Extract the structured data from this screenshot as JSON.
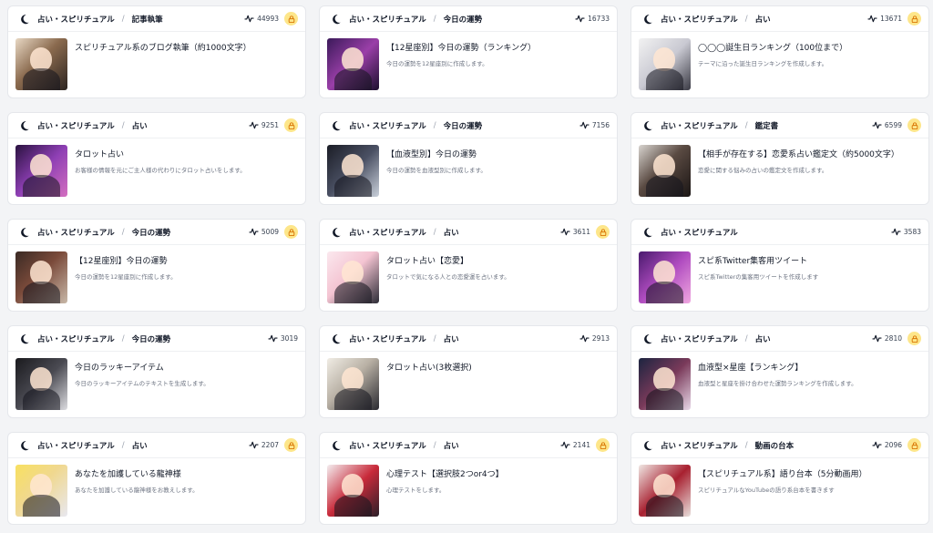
{
  "cards": [
    {
      "category": "占い・スピリチュアル",
      "sub": "記事執筆",
      "count": "44993",
      "locked": true,
      "title": "スピリチュアル系のブログ執筆（約1000文字）",
      "desc": "",
      "thumb_bg": "linear-gradient(135deg,#e8d8c4 0%,#8a6a4e 45%,#2c2420 100%)"
    },
    {
      "category": "占い・スピリチュアル",
      "sub": "今日の運勢",
      "count": "16733",
      "locked": false,
      "title": "【12星座別】今日の運勢（ランキング）",
      "desc": "今日の運勢を12星座別に作成します。",
      "thumb_bg": "linear-gradient(135deg,#3b1a5a 0%,#9a3fa8 50%,#1c0f2e 100%)"
    },
    {
      "category": "占い・スピリチュアル",
      "sub": "占い",
      "count": "13671",
      "locked": true,
      "title": "◯◯◯誕生日ランキング（100位まで）",
      "desc": "テーマに沿った誕生日ランキングを作成します。",
      "thumb_bg": "linear-gradient(135deg,#f2f2f2 0%,#c9c9d2 50%,#3a3a44 100%)"
    },
    {
      "category": "占い・スピリチュアル",
      "sub": "占い",
      "count": "9251",
      "locked": true,
      "title": "タロット占い",
      "desc": "お客様の情報を元にご主人様の代わりにタロット占いをします。",
      "thumb_bg": "linear-gradient(135deg,#2a1240 0%,#8e3fb4 50%,#d46fc0 100%)"
    },
    {
      "category": "占い・スピリチュアル",
      "sub": "今日の運勢",
      "count": "7156",
      "locked": false,
      "title": "【血液型別】今日の運勢",
      "desc": "今日の運勢を血液型別に作成します。",
      "thumb_bg": "linear-gradient(135deg,#1b1d26 0%,#4a5063 50%,#c9d0da 100%)"
    },
    {
      "category": "占い・スピリチュアル",
      "sub": "鑑定書",
      "count": "6599",
      "locked": true,
      "title": "【相手が存在する】恋愛系占い鑑定文（約5000文字）",
      "desc": "恋愛に関する悩みの占いの鑑定文を作成します。",
      "thumb_bg": "linear-gradient(135deg,#d8d4cf 0%,#5a4a42 45%,#1a1514 100%)"
    },
    {
      "category": "占い・スピリチュアル",
      "sub": "今日の運勢",
      "count": "5009",
      "locked": true,
      "title": "【12星座別】今日の運勢",
      "desc": "今日の運勢を12星座別に作成します。",
      "thumb_bg": "linear-gradient(135deg,#3a2a24 0%,#7a4a3a 45%,#c8b8a8 100%)"
    },
    {
      "category": "占い・スピリチュアル",
      "sub": "占い",
      "count": "3611",
      "locked": true,
      "title": "タロット占い【恋愛】",
      "desc": "タロットで気になる人との恋愛運を占います。",
      "thumb_bg": "linear-gradient(135deg,#fbe8ee 0%,#f4c4d2 45%,#2c2c36 100%)"
    },
    {
      "category": "占い・スピリチュアル",
      "sub": "",
      "count": "3583",
      "locked": false,
      "title": "スピ系Twitter集客用ツイート",
      "desc": "スピ系Twitterの集客用ツイートを作成します",
      "thumb_bg": "linear-gradient(135deg,#4a1a6e 0%,#b04cc0 50%,#f0a8e0 100%)"
    },
    {
      "category": "占い・スピリチュアル",
      "sub": "今日の運勢",
      "count": "3019",
      "locked": false,
      "title": "今日のラッキーアイテム",
      "desc": "今日のラッキーアイテムのテキストを生成します。",
      "thumb_bg": "linear-gradient(135deg,#1a1a1e 0%,#4a4a52 50%,#dcdce0 100%)"
    },
    {
      "category": "占い・スピリチュアル",
      "sub": "占い",
      "count": "2913",
      "locked": false,
      "title": "タロット占い(3枚選択)",
      "desc": "",
      "thumb_bg": "linear-gradient(135deg,#f0ece4 0%,#b8b0a4 45%,#2a2a30 100%)"
    },
    {
      "category": "占い・スピリチュアル",
      "sub": "占い",
      "count": "2810",
      "locked": true,
      "title": "血液型×星座【ランキング】",
      "desc": "血液型と星座を掛け合わせた運勢ランキングを作成します。",
      "thumb_bg": "linear-gradient(135deg,#1c2440 0%,#7a3a5a 50%,#e8d8e8 100%)"
    },
    {
      "category": "占い・スピリチュアル",
      "sub": "占い",
      "count": "2207",
      "locked": true,
      "title": "あなたを加護している龍神様",
      "desc": "あなたを加護している龍神様をお教えします。",
      "thumb_bg": "linear-gradient(135deg,#f8e060 0%,#f0d890 45%,#e8e8f0 100%)"
    },
    {
      "category": "占い・スピリチュアル",
      "sub": "占い",
      "count": "2141",
      "locked": true,
      "title": "心理テスト【選択肢2つor4つ】",
      "desc": "心理テストをします。",
      "thumb_bg": "linear-gradient(135deg,#f4eef0 0%,#c82a3a 50%,#2a2028 100%)"
    },
    {
      "category": "占い・スピリチュアル",
      "sub": "動画の台本",
      "count": "2096",
      "locked": true,
      "title": "【スピリチュアル系】語り台本（5分動画用）",
      "desc": "スピリチュアルなYouTubeの語り系台本を書きます",
      "thumb_bg": "linear-gradient(135deg,#f0e8e4 0%,#a82030 50%,#e8e0dc 100%)"
    }
  ],
  "icons": {
    "category": "moon-icon",
    "count": "activity-icon",
    "lock": "lock-icon"
  },
  "colors": {
    "lock_badge": "#fde68a",
    "lock_icon": "#d97706"
  }
}
